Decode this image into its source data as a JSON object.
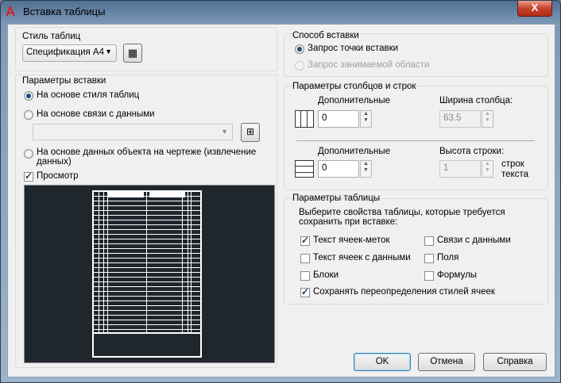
{
  "window": {
    "title": "Вставка таблицы",
    "close_label": "X"
  },
  "table_style": {
    "label": "Стиль таблиц",
    "selected": "Спецификация А4"
  },
  "insert_options": {
    "label": "Параметры вставки",
    "from_style": "На основе стиля таблиц",
    "from_data_link": "На основе связи с данными",
    "from_object_data": "На основе данных объекта на чертеже (извлечение",
    "from_object_data_2": "данных)",
    "preview": "Просмотр"
  },
  "insertion_behavior": {
    "label": "Способ вставки",
    "specify_point": "Запрос точки вставки",
    "specify_window": "Запрос занимаемой области"
  },
  "col_row": {
    "label": "Параметры столбцов и строк",
    "columns_label": "Дополнительные",
    "columns_value": "0",
    "col_width_label": "Ширина столбца:",
    "col_width_value": "63.5",
    "rows_label": "Дополнительные",
    "rows_value": "0",
    "row_height_label": "Высота строки:",
    "row_height_value": "1",
    "row_units_1": "строк",
    "row_units_2": "текста"
  },
  "table_params": {
    "label": "Параметры таблицы",
    "desc_1": "Выберите свойства таблицы, которые требуется",
    "desc_2": "сохранить при вставке:",
    "label_text": "Текст ячеек-меток",
    "data_links": "Связи с данными",
    "data_text": "Текст ячеек с данными",
    "fields": "Поля",
    "blocks": "Блоки",
    "formulas": "Формулы",
    "keep_overrides": "Сохранять переопределения стилей ячеек"
  },
  "buttons": {
    "ok": "OK",
    "cancel": "Отмена",
    "help": "Справка"
  }
}
